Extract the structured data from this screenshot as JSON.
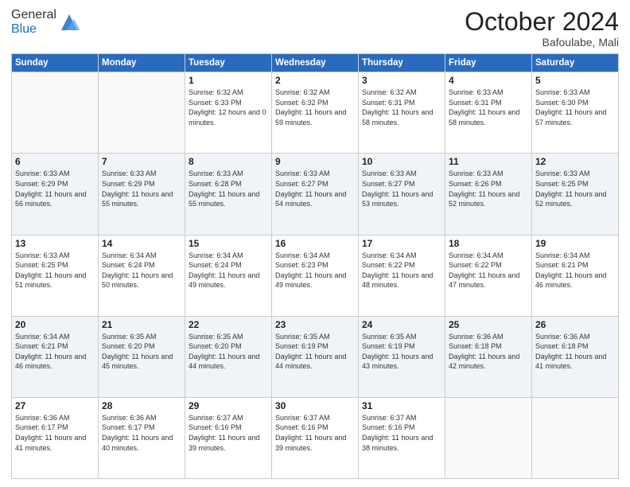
{
  "header": {
    "logo_general": "General",
    "logo_blue": "Blue",
    "month": "October 2024",
    "location": "Bafoulabe, Mali"
  },
  "days_of_week": [
    "Sunday",
    "Monday",
    "Tuesday",
    "Wednesday",
    "Thursday",
    "Friday",
    "Saturday"
  ],
  "weeks": [
    [
      {
        "day": "",
        "detail": ""
      },
      {
        "day": "",
        "detail": ""
      },
      {
        "day": "1",
        "detail": "Sunrise: 6:32 AM\nSunset: 6:33 PM\nDaylight: 12 hours\nand 0 minutes."
      },
      {
        "day": "2",
        "detail": "Sunrise: 6:32 AM\nSunset: 6:32 PM\nDaylight: 11 hours\nand 59 minutes."
      },
      {
        "day": "3",
        "detail": "Sunrise: 6:32 AM\nSunset: 6:31 PM\nDaylight: 11 hours\nand 58 minutes."
      },
      {
        "day": "4",
        "detail": "Sunrise: 6:33 AM\nSunset: 6:31 PM\nDaylight: 11 hours\nand 58 minutes."
      },
      {
        "day": "5",
        "detail": "Sunrise: 6:33 AM\nSunset: 6:30 PM\nDaylight: 11 hours\nand 57 minutes."
      }
    ],
    [
      {
        "day": "6",
        "detail": "Sunrise: 6:33 AM\nSunset: 6:29 PM\nDaylight: 11 hours\nand 56 minutes."
      },
      {
        "day": "7",
        "detail": "Sunrise: 6:33 AM\nSunset: 6:29 PM\nDaylight: 11 hours\nand 55 minutes."
      },
      {
        "day": "8",
        "detail": "Sunrise: 6:33 AM\nSunset: 6:28 PM\nDaylight: 11 hours\nand 55 minutes."
      },
      {
        "day": "9",
        "detail": "Sunrise: 6:33 AM\nSunset: 6:27 PM\nDaylight: 11 hours\nand 54 minutes."
      },
      {
        "day": "10",
        "detail": "Sunrise: 6:33 AM\nSunset: 6:27 PM\nDaylight: 11 hours\nand 53 minutes."
      },
      {
        "day": "11",
        "detail": "Sunrise: 6:33 AM\nSunset: 6:26 PM\nDaylight: 11 hours\nand 52 minutes."
      },
      {
        "day": "12",
        "detail": "Sunrise: 6:33 AM\nSunset: 6:25 PM\nDaylight: 11 hours\nand 52 minutes."
      }
    ],
    [
      {
        "day": "13",
        "detail": "Sunrise: 6:33 AM\nSunset: 6:25 PM\nDaylight: 11 hours\nand 51 minutes."
      },
      {
        "day": "14",
        "detail": "Sunrise: 6:34 AM\nSunset: 6:24 PM\nDaylight: 11 hours\nand 50 minutes."
      },
      {
        "day": "15",
        "detail": "Sunrise: 6:34 AM\nSunset: 6:24 PM\nDaylight: 11 hours\nand 49 minutes."
      },
      {
        "day": "16",
        "detail": "Sunrise: 6:34 AM\nSunset: 6:23 PM\nDaylight: 11 hours\nand 49 minutes."
      },
      {
        "day": "17",
        "detail": "Sunrise: 6:34 AM\nSunset: 6:22 PM\nDaylight: 11 hours\nand 48 minutes."
      },
      {
        "day": "18",
        "detail": "Sunrise: 6:34 AM\nSunset: 6:22 PM\nDaylight: 11 hours\nand 47 minutes."
      },
      {
        "day": "19",
        "detail": "Sunrise: 6:34 AM\nSunset: 6:21 PM\nDaylight: 11 hours\nand 46 minutes."
      }
    ],
    [
      {
        "day": "20",
        "detail": "Sunrise: 6:34 AM\nSunset: 6:21 PM\nDaylight: 11 hours\nand 46 minutes."
      },
      {
        "day": "21",
        "detail": "Sunrise: 6:35 AM\nSunset: 6:20 PM\nDaylight: 11 hours\nand 45 minutes."
      },
      {
        "day": "22",
        "detail": "Sunrise: 6:35 AM\nSunset: 6:20 PM\nDaylight: 11 hours\nand 44 minutes."
      },
      {
        "day": "23",
        "detail": "Sunrise: 6:35 AM\nSunset: 6:19 PM\nDaylight: 11 hours\nand 44 minutes."
      },
      {
        "day": "24",
        "detail": "Sunrise: 6:35 AM\nSunset: 6:19 PM\nDaylight: 11 hours\nand 43 minutes."
      },
      {
        "day": "25",
        "detail": "Sunrise: 6:36 AM\nSunset: 6:18 PM\nDaylight: 11 hours\nand 42 minutes."
      },
      {
        "day": "26",
        "detail": "Sunrise: 6:36 AM\nSunset: 6:18 PM\nDaylight: 11 hours\nand 41 minutes."
      }
    ],
    [
      {
        "day": "27",
        "detail": "Sunrise: 6:36 AM\nSunset: 6:17 PM\nDaylight: 11 hours\nand 41 minutes."
      },
      {
        "day": "28",
        "detail": "Sunrise: 6:36 AM\nSunset: 6:17 PM\nDaylight: 11 hours\nand 40 minutes."
      },
      {
        "day": "29",
        "detail": "Sunrise: 6:37 AM\nSunset: 6:16 PM\nDaylight: 11 hours\nand 39 minutes."
      },
      {
        "day": "30",
        "detail": "Sunrise: 6:37 AM\nSunset: 6:16 PM\nDaylight: 11 hours\nand 39 minutes."
      },
      {
        "day": "31",
        "detail": "Sunrise: 6:37 AM\nSunset: 6:16 PM\nDaylight: 11 hours\nand 38 minutes."
      },
      {
        "day": "",
        "detail": ""
      },
      {
        "day": "",
        "detail": ""
      }
    ]
  ]
}
